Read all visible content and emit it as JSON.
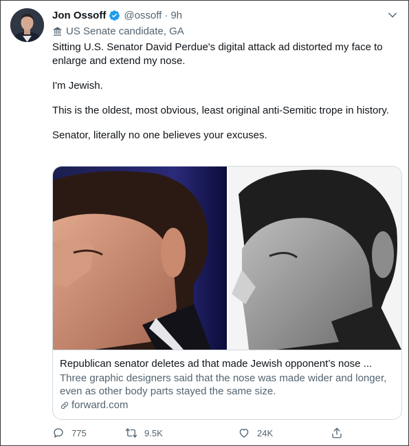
{
  "author": {
    "name": "Jon Ossoff",
    "handle": "@ossoff",
    "separator": "·",
    "time": "9h",
    "label": "US Senate candidate, GA"
  },
  "tweet": {
    "paragraphs": [
      "Sitting U.S. Senator David Perdue's digital attack ad distorted my face to enlarge and extend my nose.",
      "I'm Jewish.",
      "This is the oldest, most obvious, least original anti-Semitic trope in history.",
      "Senator, literally no one believes your excuses."
    ]
  },
  "card": {
    "title": "Republican senator deletes ad that made Jewish opponent’s nose ...",
    "description": "Three graphic designers said that the nose was made wider and longer, even as other body parts stayed the same size.",
    "domain": "forward.com"
  },
  "actions": {
    "reply_count": "775",
    "retweet_count": "9.5K",
    "like_count": "24K"
  },
  "colors": {
    "verified": "#1d9bf0",
    "secondary_text": "#536471",
    "border": "#cfd9de"
  },
  "icons": {
    "verified": "verified-badge-icon",
    "chevron": "chevron-down-icon",
    "label": "government-building-icon",
    "link": "link-icon",
    "reply": "reply-icon",
    "retweet": "retweet-icon",
    "like": "heart-icon",
    "share": "share-icon"
  }
}
